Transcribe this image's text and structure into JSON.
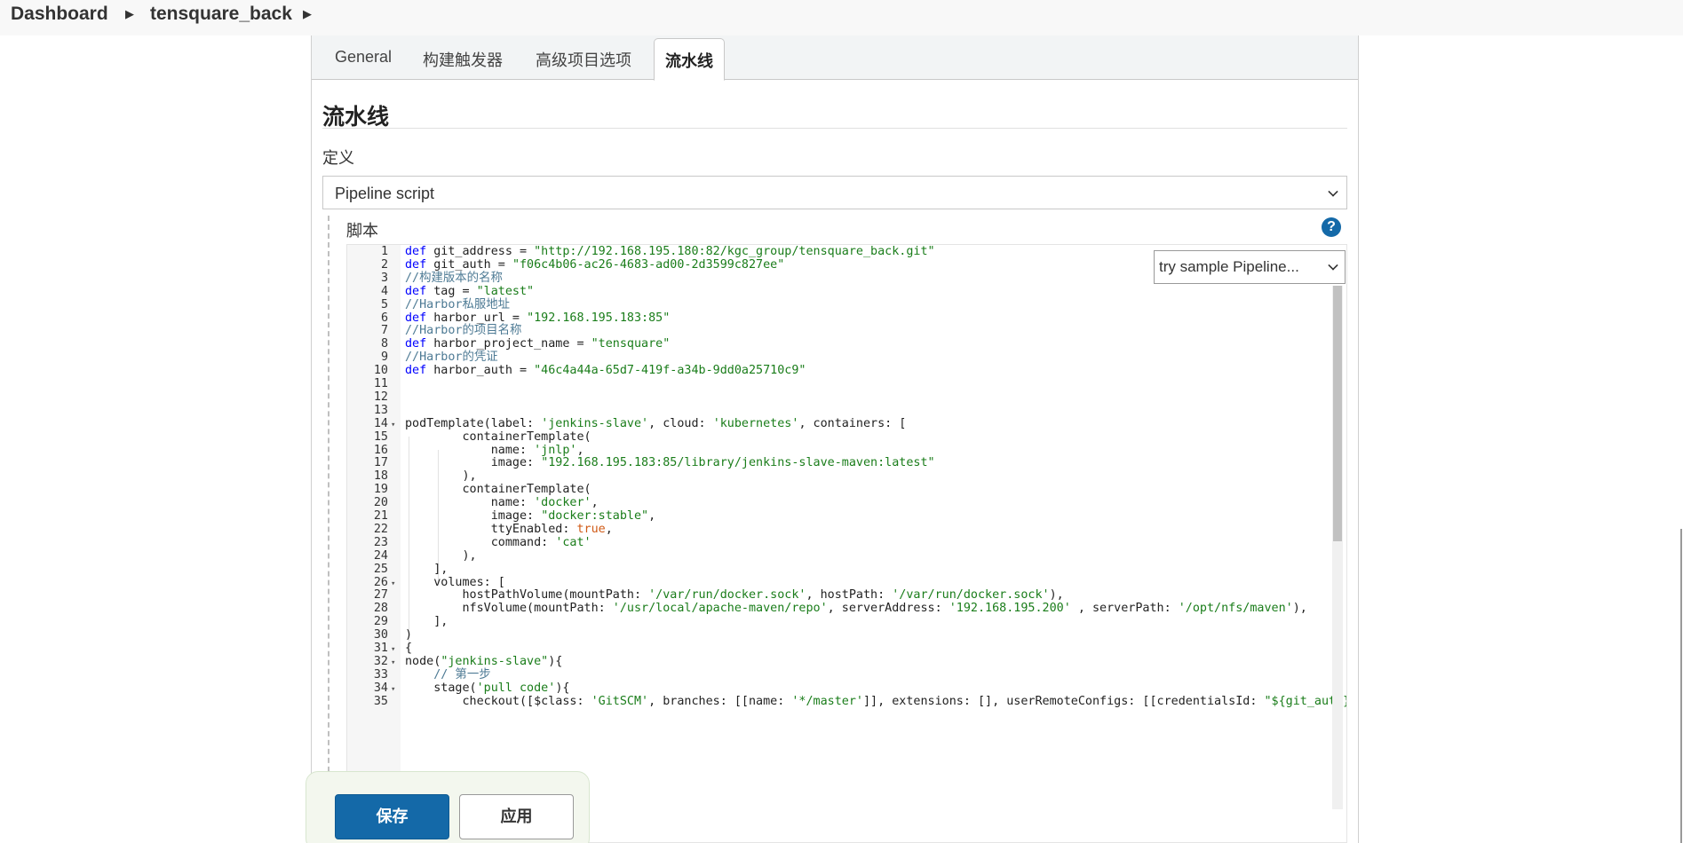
{
  "breadcrumb": {
    "items": [
      "Dashboard",
      "tensquare_back"
    ]
  },
  "tabs": [
    {
      "label": "General",
      "active": false
    },
    {
      "label": "构建触发器",
      "active": false
    },
    {
      "label": "高级项目选项",
      "active": false
    },
    {
      "label": "流水线",
      "active": true
    }
  ],
  "section": {
    "title": "流水线",
    "definition_label": "定义",
    "definition_value": "Pipeline script",
    "script_label": "脚本",
    "help": "?"
  },
  "editor": {
    "sample_select": "try sample Pipeline...",
    "lines": [
      {
        "n": "1",
        "fold": "",
        "html": "<span class=\"kw\">def</span> git_address = <span class=\"str\">\"http://192.168.195.180:82/kgc_group/tensquare_back.git\"</span>"
      },
      {
        "n": "2",
        "fold": "",
        "html": "<span class=\"kw\">def</span> git_auth = <span class=\"str\">\"f06c4b06-ac26-4683-ad00-2d3599c827ee\"</span>"
      },
      {
        "n": "3",
        "fold": "",
        "html": "<span class=\"cmt\">//构建版本的名称</span>"
      },
      {
        "n": "4",
        "fold": "",
        "html": "<span class=\"kw\">def</span> tag = <span class=\"str\">\"latest\"</span>"
      },
      {
        "n": "5",
        "fold": "",
        "html": "<span class=\"cmt\">//Harbor私服地址</span>"
      },
      {
        "n": "6",
        "fold": "",
        "html": "<span class=\"kw\">def</span> harbor_url = <span class=\"str\">\"192.168.195.183:85\"</span>"
      },
      {
        "n": "7",
        "fold": "",
        "html": "<span class=\"cmt\">//Harbor的项目名称</span>"
      },
      {
        "n": "8",
        "fold": "",
        "html": "<span class=\"kw\">def</span> harbor_project_name = <span class=\"str\">\"tensquare\"</span>"
      },
      {
        "n": "9",
        "fold": "",
        "html": "<span class=\"cmt\">//Harbor的凭证</span>"
      },
      {
        "n": "10",
        "fold": "",
        "html": "<span class=\"kw\">def</span> harbor_auth = <span class=\"str\">\"46c4a44a-65d7-419f-a34b-9dd0a25710c9\"</span>"
      },
      {
        "n": "11",
        "fold": "",
        "html": ""
      },
      {
        "n": "12",
        "fold": "",
        "html": ""
      },
      {
        "n": "13",
        "fold": "",
        "html": ""
      },
      {
        "n": "14",
        "fold": "▾",
        "html": "podTemplate(label: <span class=\"str\">'jenkins-slave'</span>, cloud: <span class=\"str\">'kubernetes'</span>, containers: ["
      },
      {
        "n": "15",
        "fold": "",
        "html": "        containerTemplate("
      },
      {
        "n": "16",
        "fold": "",
        "html": "            name: <span class=\"str\">'jnlp'</span>,"
      },
      {
        "n": "17",
        "fold": "",
        "html": "            image: <span class=\"str\">\"192.168.195.183:85/library/jenkins-slave-maven:latest\"</span>"
      },
      {
        "n": "18",
        "fold": "",
        "html": "        ),"
      },
      {
        "n": "19",
        "fold": "",
        "html": "        containerTemplate("
      },
      {
        "n": "20",
        "fold": "",
        "html": "            name: <span class=\"str\">'docker'</span>,"
      },
      {
        "n": "21",
        "fold": "",
        "html": "            image: <span class=\"str\">\"docker:stable\"</span>,"
      },
      {
        "n": "22",
        "fold": "",
        "html": "            ttyEnabled: <span class=\"lit\">true</span>,"
      },
      {
        "n": "23",
        "fold": "",
        "html": "            command: <span class=\"str\">'cat'</span>"
      },
      {
        "n": "24",
        "fold": "",
        "html": "        ),"
      },
      {
        "n": "25",
        "fold": "",
        "html": "    ],"
      },
      {
        "n": "26",
        "fold": "▾",
        "html": "    volumes: ["
      },
      {
        "n": "27",
        "fold": "",
        "html": "        hostPathVolume(mountPath: <span class=\"str\">'/var/run/docker.sock'</span>, hostPath: <span class=\"str\">'/var/run/docker.sock'</span>),"
      },
      {
        "n": "28",
        "fold": "",
        "html": "        nfsVolume(mountPath: <span class=\"str\">'/usr/local/apache-maven/repo'</span>, serverAddress: <span class=\"str\">'192.168.195.200'</span> , serverPath: <span class=\"str\">'/opt/nfs/maven'</span>),"
      },
      {
        "n": "29",
        "fold": "",
        "html": "    ],"
      },
      {
        "n": "30",
        "fold": "",
        "html": ")"
      },
      {
        "n": "31",
        "fold": "▾",
        "html": "{"
      },
      {
        "n": "32",
        "fold": "▾",
        "html": "node(<span class=\"str\">\"jenkins-slave\"</span>){"
      },
      {
        "n": "33",
        "fold": "",
        "html": "    <span class=\"cmt\">// 第一步</span>"
      },
      {
        "n": "34",
        "fold": "▾",
        "html": "    stage(<span class=\"str\">'pull code'</span>){"
      },
      {
        "n": "35",
        "fold": "",
        "html": "        checkout([$class: <span class=\"str\">'GitSCM'</span>, branches: [[name: <span class=\"str\">'*/master'</span>]], extensions: [], userRemoteConfigs: [[credentialsId: <span class=\"str\">\"${git_auth}\"</span>"
      }
    ]
  },
  "buttons": {
    "save": "保存",
    "apply": "应用"
  }
}
